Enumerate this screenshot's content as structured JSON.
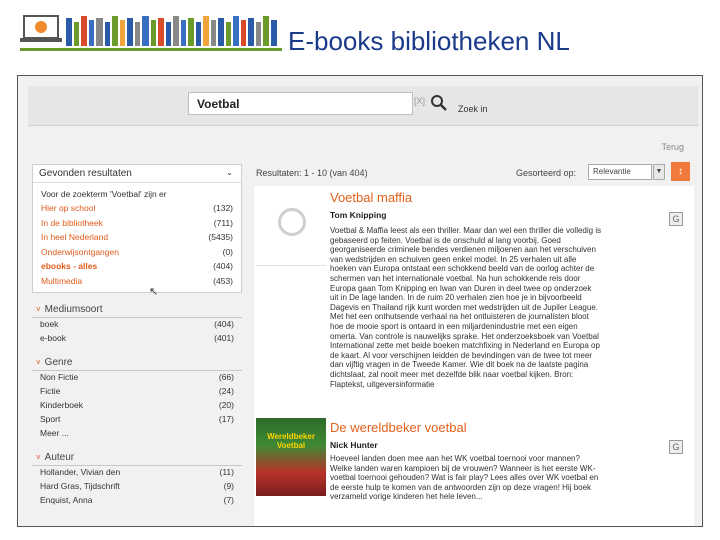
{
  "slide": {
    "title": "E-books bibliotheken NL",
    "brand_color": "#1a3a8a",
    "accent_color": "#6a9a2a"
  },
  "search": {
    "value": "Voetbal",
    "clear_label": "[X]",
    "button_icon": "search-icon",
    "zoek_in_label": "Zoek in"
  },
  "terug_label": "Terug",
  "facets": {
    "header": "Gevonden resultaten",
    "note": "Voor de zoekterm 'Voetbal' zijn er",
    "items": [
      {
        "label": "Hier op school",
        "count": "(132)"
      },
      {
        "label": "In de bibliotheek",
        "count": "(711)"
      },
      {
        "label": "In heel Nederland",
        "count": "(5435)"
      },
      {
        "label": "Onderwijsontgangen",
        "count": "(0)"
      },
      {
        "label": "ebooks - alles",
        "count": "(404)"
      },
      {
        "label": "Multimedia",
        "count": "(453)"
      }
    ]
  },
  "medium": {
    "header": "Mediumsoort",
    "items": [
      {
        "label": "boek",
        "count": "(404)"
      },
      {
        "label": "e-book",
        "count": "(401)"
      }
    ]
  },
  "genre": {
    "header": "Genre",
    "items": [
      {
        "label": "Non Fictie",
        "count": "(66)"
      },
      {
        "label": "Fictie",
        "count": "(24)"
      },
      {
        "label": "Kinderboek",
        "count": "(20)"
      },
      {
        "label": "Sport",
        "count": "(17)"
      },
      {
        "label": "Meer ...",
        "count": ""
      }
    ]
  },
  "auteur": {
    "header": "Auteur",
    "items": [
      {
        "label": "Hollander, Vivian den",
        "count": "(11)"
      },
      {
        "label": "Hard Gras, Tijdschrift",
        "count": "(9)"
      },
      {
        "label": "Enquist, Anna",
        "count": "(7)"
      }
    ]
  },
  "results_header": {
    "count_text": "Resultaten: 1 - 10 (van 404)",
    "sort_label": "Gesorteerd op:",
    "sort_value": "Relevantie",
    "sort_button": "↕"
  },
  "results": [
    {
      "title": "Voetbal maffia",
      "author": "Tom Knipping",
      "description": "Voetbal & Maffia leest als een thriller. Maar dan wel een thriller die volledig is gebaseerd op feiten. Voetbal is de onschuld al lang voorbij. Goed georganiseerde criminele bendes verdienen miljoenen aan het verschuiven van wedstrijden en schuiven geen enkel model. In 25 verhalen uit alle hoeken van Europa ontstaat een schokkend beeld van de oorlog achter de schermen van het internationale voetbal. Na hun schokkende reis door Europa gaan Tom Knipping en Iwan van Duren in deel twee op onderzoek uit in De lage landen. In de ruim 20 verhalen zien hoe je in bijvoorbeeld Dagevis en Thailand rijk kunt worden met wedstrijden uit de Jupiler League. Met het een onthutsende verhaal na het ontluisteren de journalisten bloot hoe de mooie sport is ontaard in een miljardenindustrie met een eigen omerta. Van controle is nauwelijks sprake. Het onderzoeksboek van Voetbal International zette met beide boeken matchfixing in Nederland en Europa op de kaart. Al voor verschijnen leidden de bevindingen van de twee tot meer dan vijftig vragen in de Tweede Kamer. Wie dit boek na de laatste pagina dichtslaat, zal nooit meer met dezelfde blik naar voetbal kijken. Bron: Flaptekst, uitgeversinformatie",
      "thumb": "placeholder",
      "badge_icon": "ebook-icon"
    },
    {
      "title": "De wereldbeker voetbal",
      "author": "Nick Hunter",
      "description": "Hoeveel landen doen mee aan het WK voetbal toernooi voor mannen? Welke landen waren kampioen bij de vrouwen? Wanneer is het eerste WK-voetbal toernooi gehouden? Wat is fair play? Lees alles over WK voetbal en de eerste hulp te komen van de antwoorden zijn op deze vragen! Hij boek verzameld vorige kinderen het hele leven...",
      "thumb": "cover",
      "cover_text": "Wereldbeker Voetbal",
      "badge_icon": "ebook-icon"
    }
  ]
}
